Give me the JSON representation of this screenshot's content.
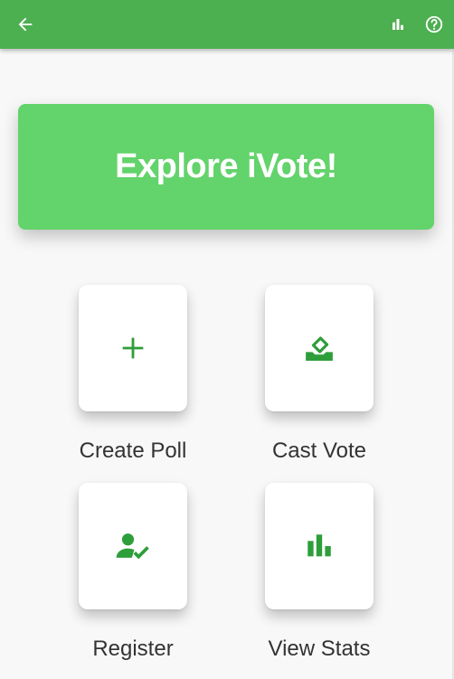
{
  "app_bar": {
    "back_icon": "arrow-back-icon",
    "stats_icon": "bar-chart-icon",
    "help_icon": "help-circle-icon",
    "color": "#4caf50"
  },
  "banner": {
    "title": "Explore iVote!",
    "color": "#63d36b"
  },
  "tiles": [
    {
      "label": "Create Poll",
      "icon": "plus-icon"
    },
    {
      "label": "Cast Vote",
      "icon": "ballot-box-icon"
    },
    {
      "label": "Register",
      "icon": "person-check-icon"
    },
    {
      "label": "View Stats",
      "icon": "bar-chart-icon"
    }
  ],
  "icon_color": "#2e9e3a"
}
